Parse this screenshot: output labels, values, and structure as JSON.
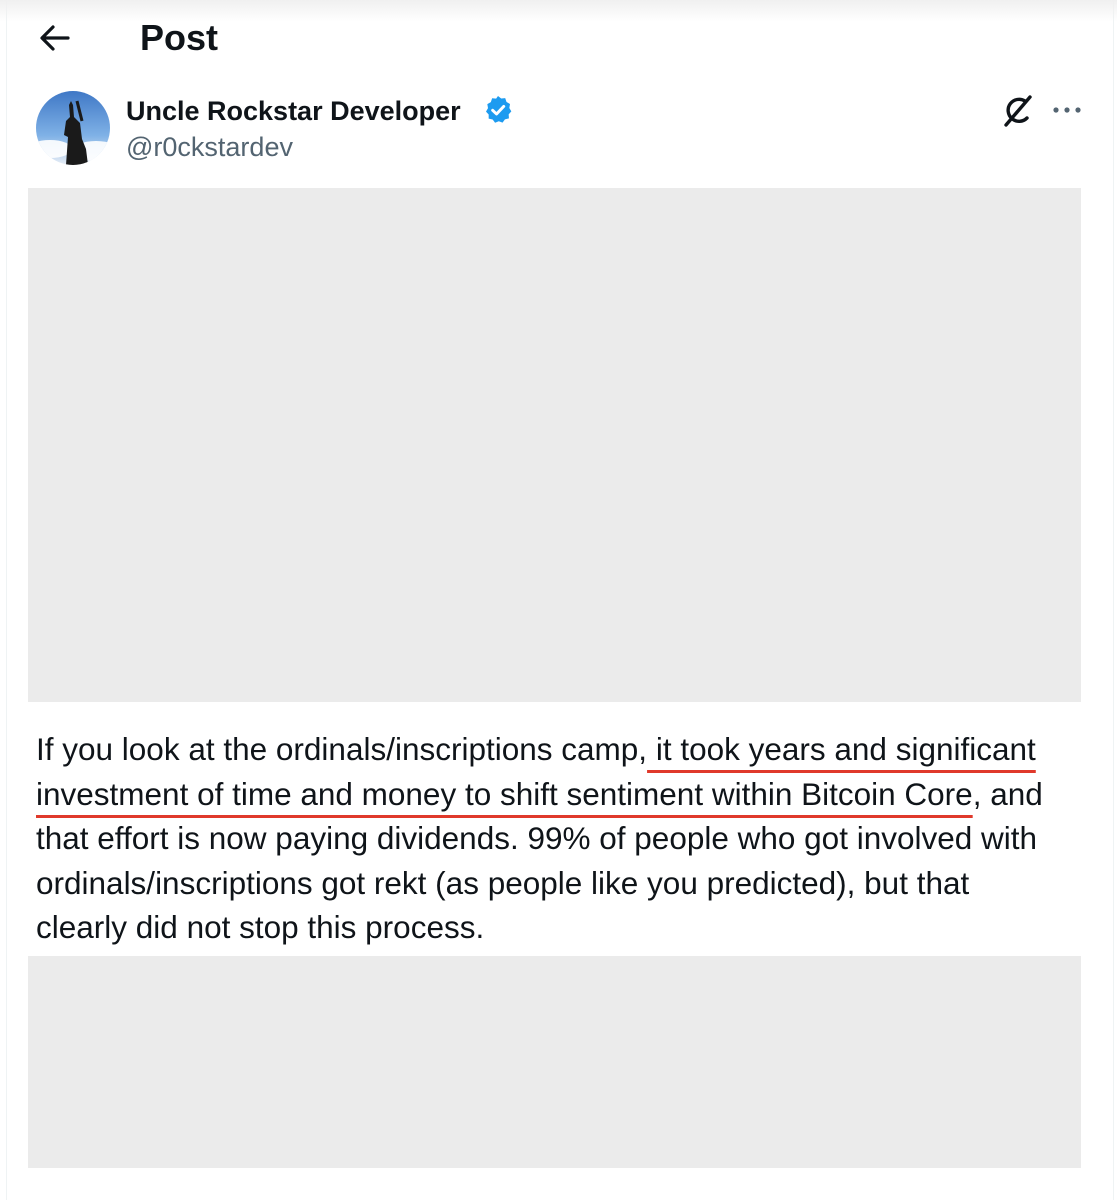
{
  "header": {
    "title": "Post",
    "back_icon": "arrow-left-icon"
  },
  "author": {
    "name": "Uncle Rockstar Developer",
    "handle": "@r0ckstardev",
    "verified_icon": "verified-badge-icon",
    "verified_color": "#1d9bf0"
  },
  "actions": {
    "grok_icon": "grok-icon",
    "more_icon": "more-horizontal-icon"
  },
  "post": {
    "lines": [
      {
        "pre": "If you look at the ordinals/inscriptions camp,",
        "hl": " it took years and significant ",
        "post": ""
      },
      {
        "pre": "",
        "hl": "investment of time and money to shift sentiment within Bitcoin Core",
        "post": ", and"
      },
      {
        "pre": "that effort is now paying dividends. 99% of people who got involved with",
        "hl": "",
        "post": ""
      },
      {
        "pre": "ordinals/inscriptions got rekt (as people like you predicted), but that",
        "hl": "",
        "post": ""
      },
      {
        "pre": "clearly did not stop this process.",
        "hl": "",
        "post": ""
      }
    ],
    "highlight_color": "#e0392b",
    "text_color": "#0f1419"
  }
}
